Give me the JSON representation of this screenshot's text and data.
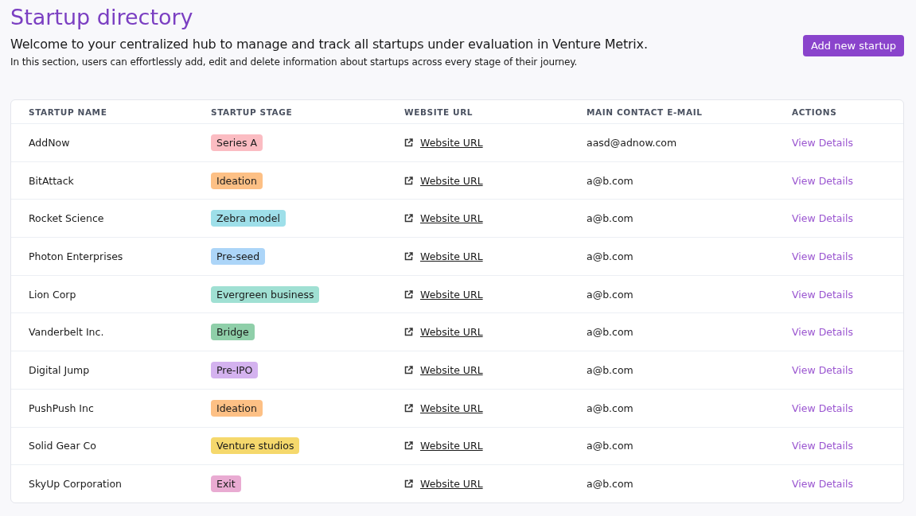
{
  "page": {
    "title": "Startup directory",
    "subtitle": "Welcome to your centralized hub to manage and track all startups under evaluation in Venture Metrix.",
    "description": "In this section, users can effortlessly add, edit and delete information about startups across every stage of their journey.",
    "add_button": "Add new startup"
  },
  "table": {
    "columns": [
      "STARTUP NAME",
      "STARTUP STAGE",
      "WEBSITE URL",
      "MAIN CONTACT E-MAIL",
      "ACTIONS"
    ],
    "rows": [
      {
        "name": "AddNow",
        "stage": "Series A",
        "color": "#fbbcc2",
        "website": "Website URL",
        "email": "aasd@adnow.com",
        "action": "View Details"
      },
      {
        "name": "BitAttack",
        "stage": "Ideation",
        "color": "#fdc085",
        "website": "Website URL",
        "email": "a@b.com",
        "action": "View Details"
      },
      {
        "name": "Rocket Science",
        "stage": "Zebra model",
        "color": "#9edfe9",
        "website": "Website URL",
        "email": "a@b.com",
        "action": "View Details"
      },
      {
        "name": "Photon Enterprises",
        "stage": "Pre-seed",
        "color": "#acd5f8",
        "website": "Website URL",
        "email": "a@b.com",
        "action": "View Details"
      },
      {
        "name": "Lion Corp",
        "stage": "Evergreen business",
        "color": "#a0e0d3",
        "website": "Website URL",
        "email": "a@b.com",
        "action": "View Details"
      },
      {
        "name": "Vanderbelt Inc.",
        "stage": "Bridge",
        "color": "#8fcfa9",
        "website": "Website URL",
        "email": "a@b.com",
        "action": "View Details"
      },
      {
        "name": "Digital Jump",
        "stage": "Pre-IPO",
        "color": "#d4b2ef",
        "website": "Website URL",
        "email": "a@b.com",
        "action": "View Details"
      },
      {
        "name": "PushPush Inc",
        "stage": "Ideation",
        "color": "#fdc085",
        "website": "Website URL",
        "email": "a@b.com",
        "action": "View Details"
      },
      {
        "name": "Solid Gear Co",
        "stage": "Venture studios",
        "color": "#f5d86c",
        "website": "Website URL",
        "email": "a@b.com",
        "action": "View Details"
      },
      {
        "name": "SkyUp Corporation",
        "stage": "Exit",
        "color": "#e9abd2",
        "website": "Website URL",
        "email": "a@b.com",
        "action": "View Details"
      }
    ]
  }
}
